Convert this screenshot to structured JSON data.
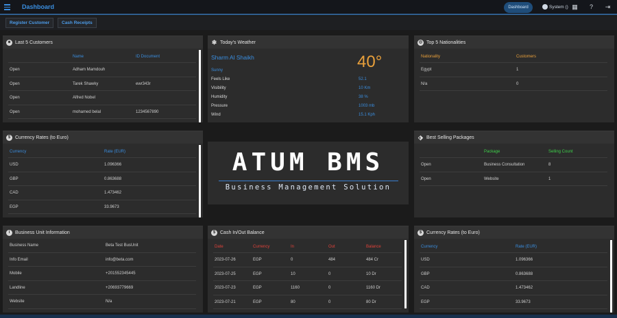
{
  "topbar": {
    "title": "Dashboard",
    "active_button": "Dashboard",
    "user_label": "System ()"
  },
  "actions": {
    "register_customer": "Register Customer",
    "cash_receipts": "Cash Receipts"
  },
  "last_customers": {
    "title": "Last 5 Customers",
    "headers": [
      "",
      "Name",
      "ID Document"
    ],
    "rows": [
      [
        "Open",
        "Adham Mamdouh",
        ""
      ],
      [
        "Open",
        "Tarek Shawky",
        "ewr343r"
      ],
      [
        "Open",
        "Alfred Nobel",
        ""
      ],
      [
        "Open",
        "mohamed belal",
        "1234567890"
      ]
    ]
  },
  "weather": {
    "title": "Today's Weather",
    "city": "Sharm Al Shaikh",
    "temp": "40°",
    "condition": "Sunny",
    "items": [
      {
        "label": "Feels Like",
        "value": "52.1"
      },
      {
        "label": "Visibility",
        "value": "10 Km"
      },
      {
        "label": "Humidity",
        "value": "38 %"
      },
      {
        "label": "Pressure",
        "value": "1003 mb"
      },
      {
        "label": "Wind",
        "value": "15.1 Kph"
      }
    ]
  },
  "nationalities": {
    "title": "Top 5 Nationalities",
    "headers": [
      "Nationality",
      "Customers"
    ],
    "rows": [
      [
        "Egypt",
        "1"
      ],
      [
        "N/a",
        "0"
      ]
    ]
  },
  "currency_left": {
    "title": "Currency Rates (to Euro)",
    "headers": [
      "Currency",
      "Rate (EUR)"
    ],
    "rows": [
      [
        "USD",
        "1.096366"
      ],
      [
        "GBP",
        "0.863688"
      ],
      [
        "CAD",
        "1.473462"
      ],
      [
        "EGP",
        "33.9673"
      ]
    ]
  },
  "logo": {
    "main": "ATUM BMS",
    "sub": "Business Management Solution"
  },
  "packages": {
    "title": "Best Selling Packages",
    "headers": [
      "",
      "Package",
      "Selling Count"
    ],
    "rows": [
      [
        "Open",
        "Business Consultation",
        "8"
      ],
      [
        "Open",
        "Website",
        "1"
      ]
    ]
  },
  "business_unit": {
    "title": "Business Unit Information",
    "rows": [
      [
        "Business Name",
        "Beta Test BusUnit"
      ],
      [
        "Info Email",
        "info@beta.com"
      ],
      [
        "Mobile",
        "+201552345445"
      ],
      [
        "Landline",
        "+20693779669"
      ],
      [
        "Website",
        "N/a"
      ]
    ]
  },
  "cash_balance": {
    "title": "Cash In/Out Balance",
    "headers": [
      "Date",
      "Currency",
      "In",
      "Out",
      "Balance"
    ],
    "rows": [
      [
        "2023-07-26",
        "EGP",
        "0",
        "484",
        "484 Cr"
      ],
      [
        "2023-07-25",
        "EGP",
        "10",
        "0",
        "10 Dr"
      ],
      [
        "2023-07-23",
        "EGP",
        "1160",
        "0",
        "1160 Dr"
      ],
      [
        "2023-07-21",
        "EGP",
        "80",
        "0",
        "80 Dr"
      ]
    ]
  },
  "currency_right": {
    "title": "Currency Rates (to Euro)",
    "headers": [
      "Currency",
      "Rate (EUR)"
    ],
    "rows": [
      [
        "USD",
        "1.096366"
      ],
      [
        "GBP",
        "0.863688"
      ],
      [
        "CAD",
        "1.473462"
      ],
      [
        "EGP",
        "33.9673"
      ]
    ]
  },
  "colors": {
    "accent": "#3a8ee0",
    "orange": "#e9a03b",
    "red": "#e0423a",
    "green": "#3ecf4a",
    "panel": "#2c2c2c"
  }
}
